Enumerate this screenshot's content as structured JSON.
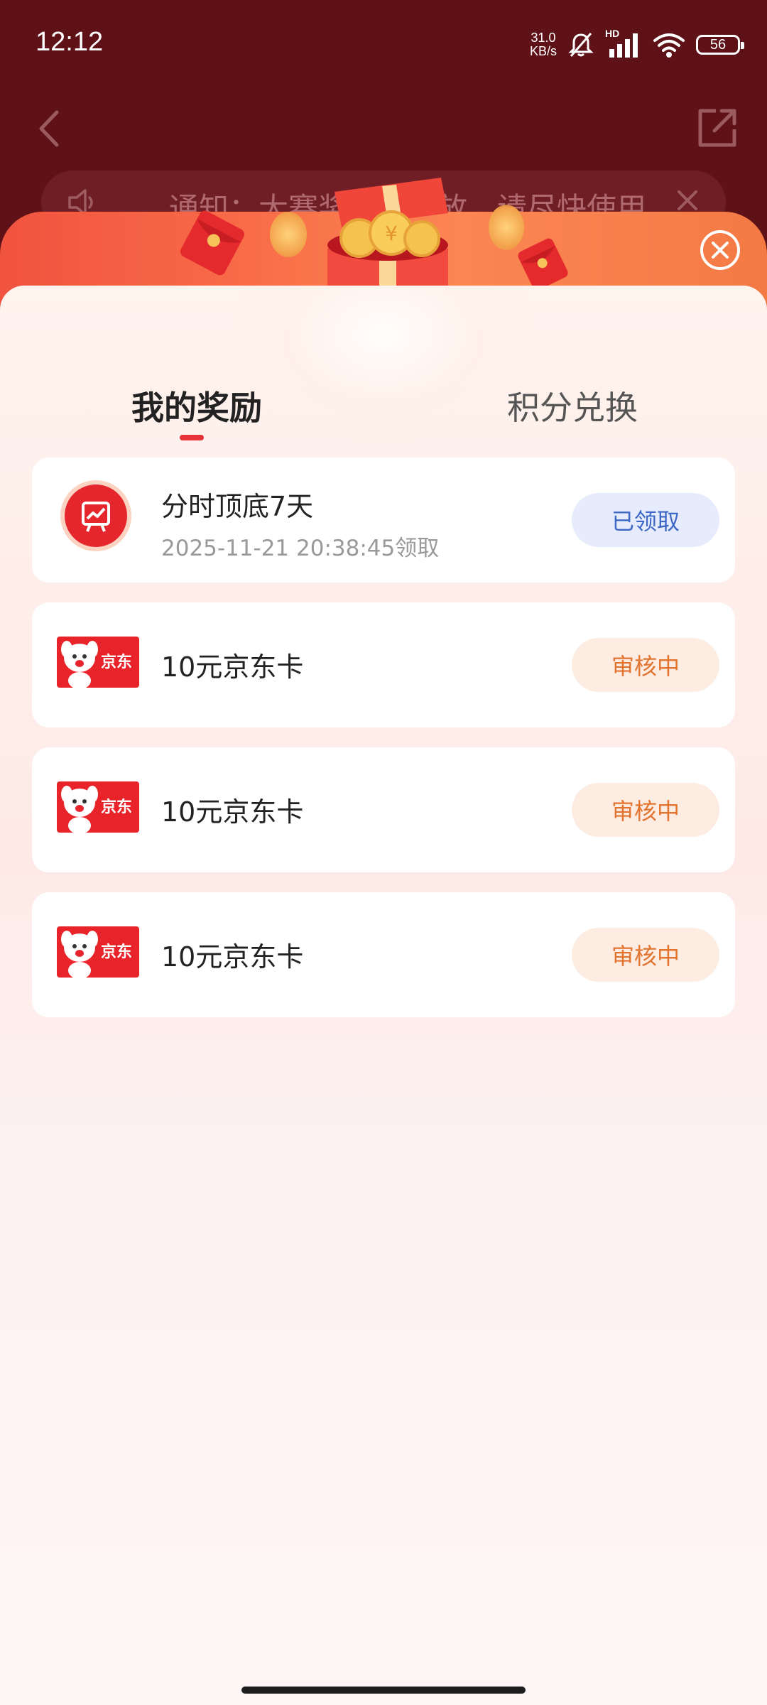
{
  "status_bar": {
    "time": "12:12",
    "net_speed_value": "31.0",
    "net_speed_unit": "KB/s",
    "signal_label": "HD",
    "battery": "56"
  },
  "notice": {
    "text": "通知：大赛奖励已发放，请尽快使用"
  },
  "tabs": [
    {
      "label": "我的奖励",
      "active": true
    },
    {
      "label": "积分兑换",
      "active": false
    }
  ],
  "rewards": [
    {
      "title": "分时顶底7天",
      "subtitle": "2025-11-21 20:38:45领取",
      "status": "已领取",
      "icon": "chart-badge-icon"
    },
    {
      "title": "10元京东卡",
      "status": "审核中",
      "icon": "jd-card-icon"
    },
    {
      "title": "10元京东卡",
      "status": "审核中",
      "icon": "jd-card-icon"
    },
    {
      "title": "10元京东卡",
      "status": "审核中",
      "icon": "jd-card-icon"
    }
  ],
  "jd_card_label": "京东",
  "colors": {
    "background": "#5e1218",
    "accent_red": "#e8323a",
    "claimed_text": "#3c67c6",
    "review_text": "#e3742f"
  }
}
